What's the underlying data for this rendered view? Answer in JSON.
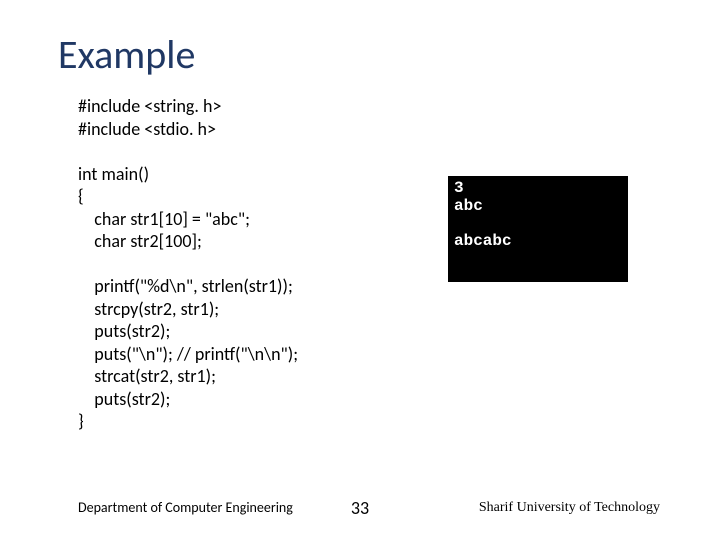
{
  "title": "Example",
  "code": "#include <string. h>\n#include <stdio. h>\n\nint main()\n{\n    char str1[10] = \"abc\";\n    char str2[100];\n\n    printf(\"%d\\n\", strlen(str1));\n    strcpy(str2, str1);\n    puts(str2);\n    puts(\"\\n\"); // printf(\"\\n\\n\");\n    strcat(str2, str1);\n    puts(str2);\n}",
  "output": "3\nabc\n\nabcabc",
  "footer": {
    "left": "Department of Computer Engineering",
    "center": "33",
    "right": "Sharif University of Technology"
  }
}
